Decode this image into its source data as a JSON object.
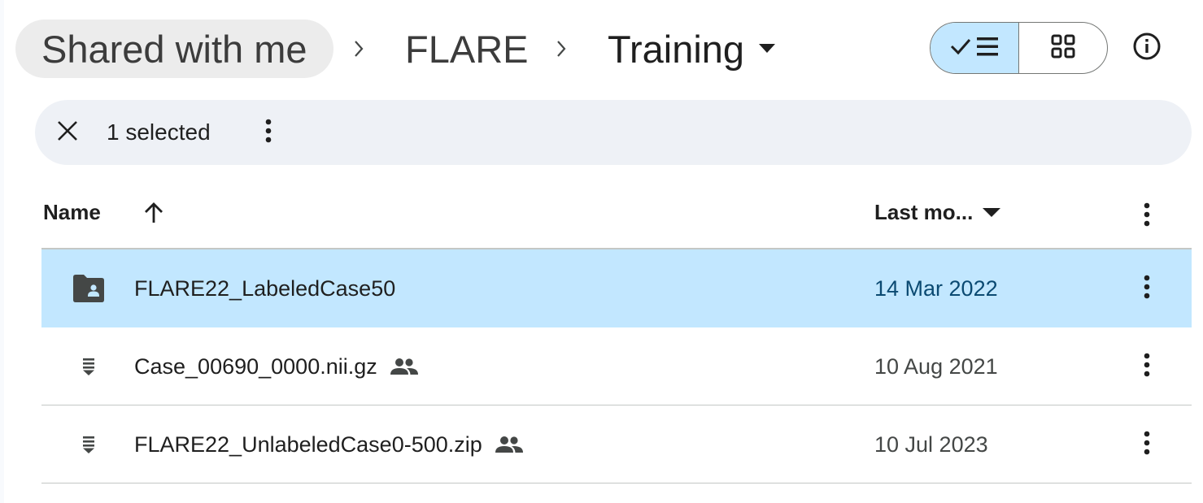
{
  "breadcrumb": {
    "root": "Shared with me",
    "parent": "FLARE",
    "current": "Training"
  },
  "view_toggle": {
    "list_icon": "check-list-icon",
    "grid_icon": "grid-icon",
    "active": "list"
  },
  "info_icon": "info-icon",
  "selection": {
    "count_label": "1 selected"
  },
  "table": {
    "columns": {
      "name": "Name",
      "modified": "Last mo..."
    },
    "sort": "ascending",
    "rows": [
      {
        "name": "FLARE22_LabeledCase50",
        "date": "14 Mar 2022",
        "icon": "shared-folder-icon",
        "shared": false,
        "selected": true
      },
      {
        "name": "Case_00690_0000.nii.gz",
        "date": "10 Aug 2021",
        "icon": "archive-file-icon",
        "shared": true,
        "selected": false
      },
      {
        "name": "FLARE22_UnlabeledCase0-500.zip",
        "date": "10 Jul 2023",
        "icon": "archive-file-icon",
        "shared": true,
        "selected": false
      }
    ]
  },
  "colors": {
    "selected_row": "#c2e7ff",
    "selection_bar": "#eef1f6",
    "breadcrumb_root_bg": "#ececec",
    "selected_date": "#0b4a72"
  }
}
